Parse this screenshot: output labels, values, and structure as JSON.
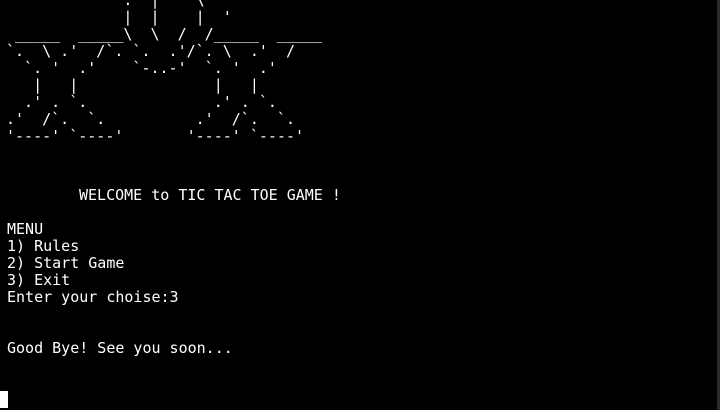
{
  "terminal": {
    "background": "#000000",
    "foreground": "#ffffff",
    "banner_art": "             .  |    \\  '\n             |  |    |  '\n _____  _____\\  \\  /  /_____  _____\n`.  \\ .'  /`. `.  .'/`. \\  .'  /\n  `. '  .'    `-..-'  `. '  .'\n   |   |               |   |\n  .' . `.              .' . `.\n.'  /`.  `.          .'  /`.  `.\n'----' `----'       '----' `----'",
    "welcome": "WELCOME to TIC TAC TOE GAME !",
    "menu_title": "MENU",
    "menu_items": [
      "1) Rules",
      "2) Start Game",
      "3) Exit"
    ],
    "prompt": "Enter your choise:3",
    "goodbye": "Good Bye! See you soon..."
  }
}
